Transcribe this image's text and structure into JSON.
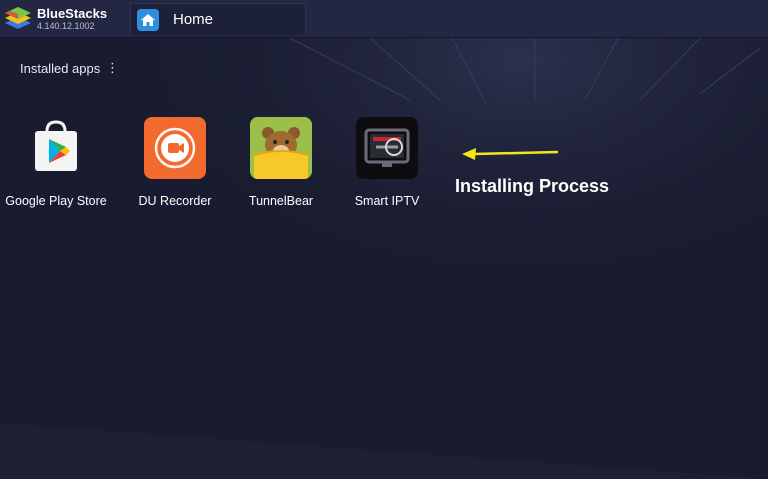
{
  "titlebar": {
    "app_name": "BlueStacks",
    "version": "4.140.12.1002",
    "tab_label": "Home"
  },
  "main": {
    "section_title": "Installed apps",
    "menu_glyph": "⋮",
    "apps": [
      {
        "label": "Google Play Store",
        "icon": "google-play-icon"
      },
      {
        "label": "DU Recorder",
        "icon": "du-recorder-icon"
      },
      {
        "label": "TunnelBear",
        "icon": "tunnelbear-icon"
      },
      {
        "label": "Smart IPTV",
        "icon": "smart-iptv-icon"
      }
    ]
  },
  "annotation": {
    "text": "Installing Process",
    "arrow_color": "#f5e61c"
  },
  "colors": {
    "background": "#1b1e33",
    "topbar": "#232743",
    "tab_icon": "#2f8fde",
    "du_orange": "#f26a2e",
    "tunnelbear_yellow": "#f6c928"
  }
}
